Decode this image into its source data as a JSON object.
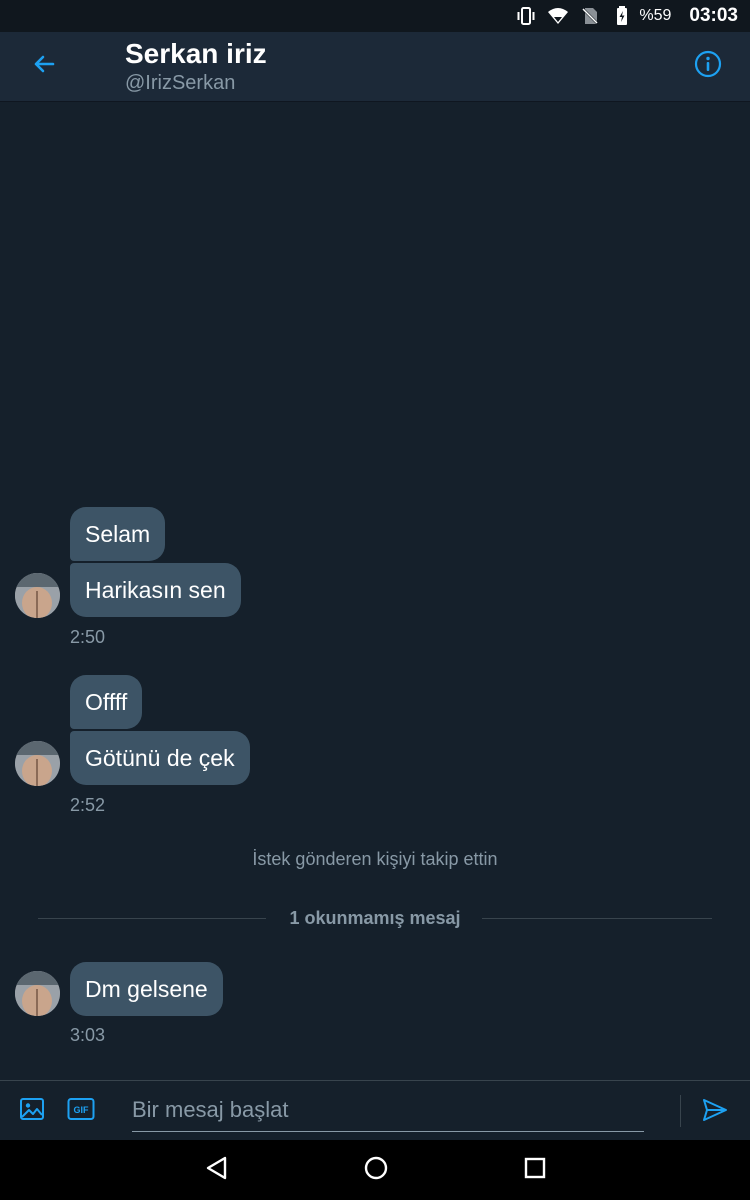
{
  "status_bar": {
    "battery_percent": "%59",
    "time": "03:03",
    "icons": [
      "vibrate-icon",
      "wifi-icon",
      "no-sim-icon",
      "battery-charging-icon"
    ]
  },
  "header": {
    "title": "Serkan iriz",
    "handle": "@IrizSerkan",
    "back_icon": "arrow-left-icon",
    "info_icon": "info-icon"
  },
  "messages": {
    "group1": {
      "msg1": "Selam",
      "msg2": "Harikasın sen",
      "time": "2:50"
    },
    "group2": {
      "msg1": "Offff",
      "msg2": "Götünü de çek",
      "time": "2:52"
    },
    "follow_notice": "İstek gönderen kişiyi takip ettin",
    "unread_divider": "1 okunmamış mesaj",
    "group3": {
      "msg1": "Dm gelsene",
      "time": "3:03"
    }
  },
  "composer": {
    "placeholder": "Bir mesaj başlat",
    "icons": [
      "image-icon",
      "gif-icon",
      "send-icon"
    ],
    "gif_label": "GIF"
  },
  "nav_bar": {
    "icons": [
      "back-triangle-icon",
      "home-circle-icon",
      "recents-square-icon"
    ]
  },
  "colors": {
    "background": "#15202b",
    "header": "#1c2938",
    "bubble": "#3d5466",
    "accent": "#1da1f2",
    "muted_text": "#8899a6"
  }
}
